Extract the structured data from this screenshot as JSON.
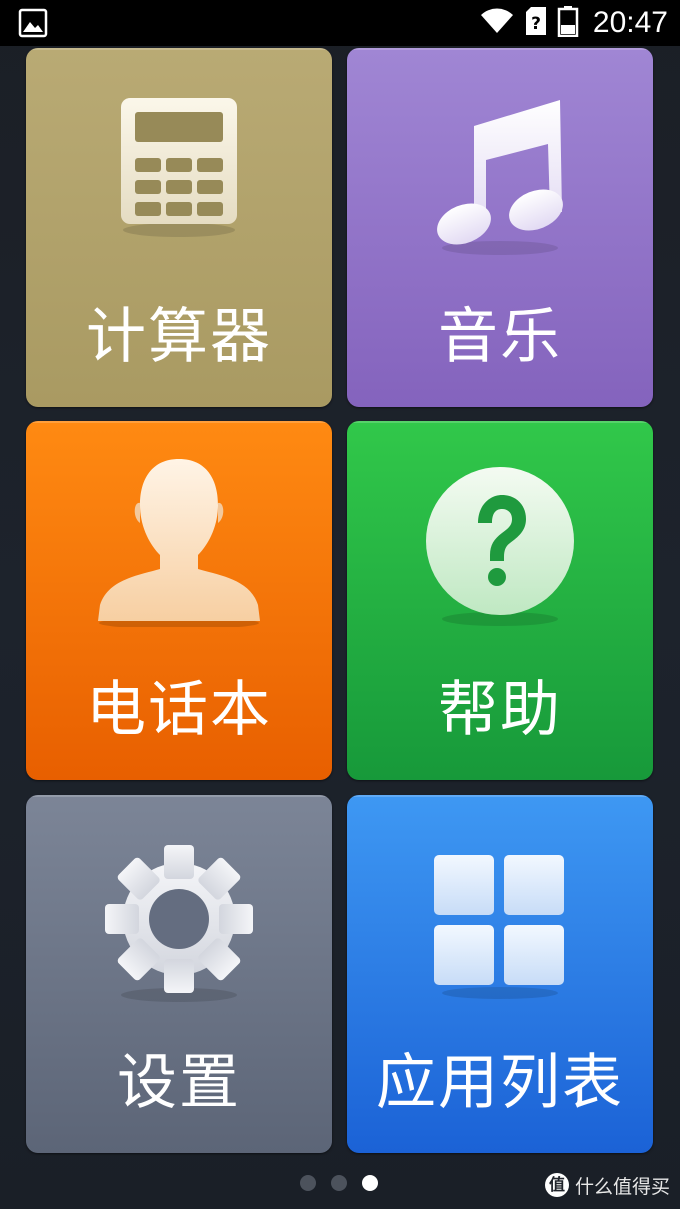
{
  "status_bar": {
    "time": "20:47",
    "icons": [
      "gallery-notification-icon",
      "wifi-icon",
      "no-sim-icon",
      "battery-icon"
    ]
  },
  "tiles": [
    {
      "label": "计算器",
      "icon": "calculator-icon",
      "color": "#b0a16a"
    },
    {
      "label": "音乐",
      "icon": "music-note-icon",
      "color": "#9275c8"
    },
    {
      "label": "电话本",
      "icon": "contact-person-icon",
      "color": "#f57808"
    },
    {
      "label": "帮助",
      "icon": "help-question-icon",
      "color": "#24b142"
    },
    {
      "label": "设置",
      "icon": "gear-icon",
      "color": "#6c7588"
    },
    {
      "label": "应用列表",
      "icon": "app-grid-icon",
      "color": "#2c7de5"
    }
  ],
  "pager": {
    "count": 3,
    "active_index": 2
  },
  "watermark": {
    "text": "什么值得买",
    "badge": "值"
  }
}
